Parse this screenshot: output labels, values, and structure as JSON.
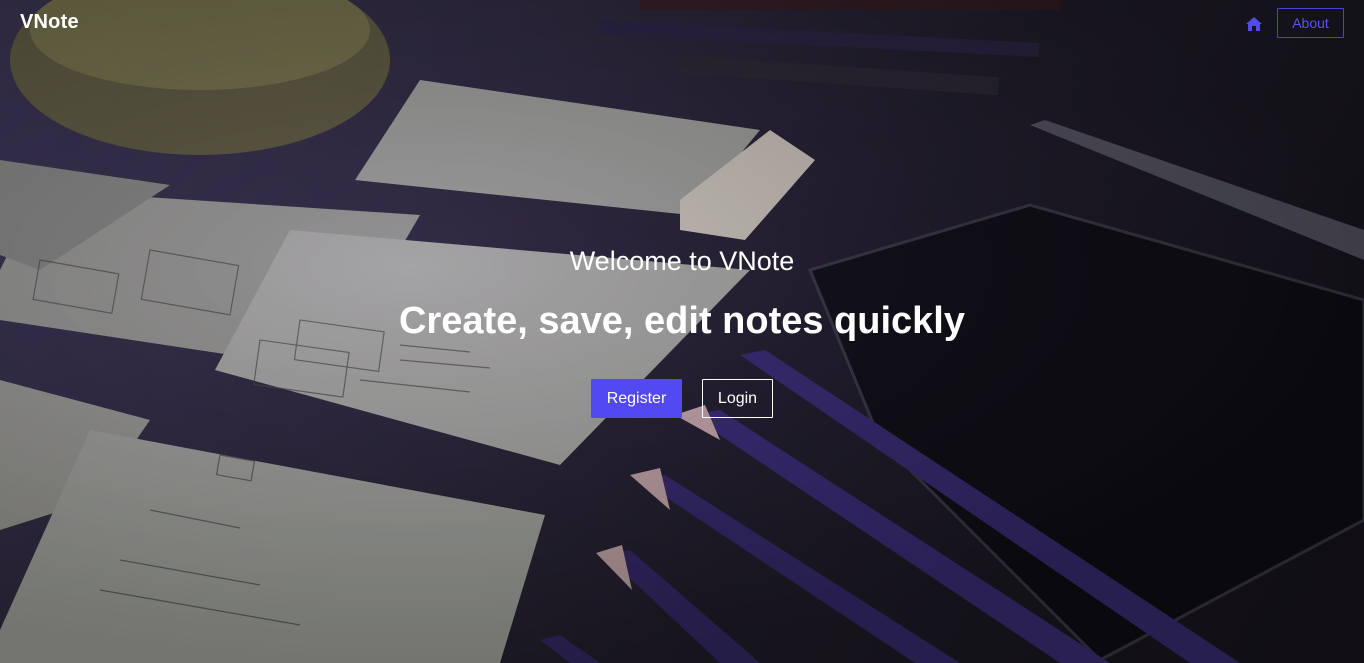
{
  "navbar": {
    "brand": "VNote",
    "home_icon": "home-icon",
    "about_label": "About"
  },
  "hero": {
    "welcome": "Welcome to VNote",
    "tagline": "Create, save, edit notes quickly",
    "register_label": "Register",
    "login_label": "Login"
  },
  "colors": {
    "accent": "#5249f0",
    "about_border": "#4a3fe0",
    "text": "#ffffff"
  }
}
